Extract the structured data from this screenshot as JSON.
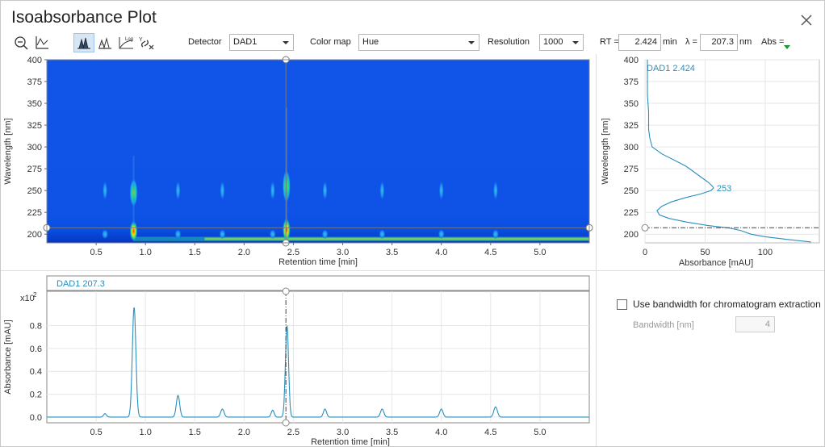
{
  "window": {
    "title": "Isoabsorbance Plot"
  },
  "toolbar": {
    "icons": [
      "zoom-out-icon",
      "chromatogram-axes-icon",
      "isoabsorbance-peaks-icon",
      "peaks-outline-icon",
      "log-scale-icon",
      "unlink-axes-icon"
    ],
    "log_label": "Log",
    "detector_label": "Detector",
    "detector_value": "DAD1",
    "colormap_label": "Color map",
    "colormap_value": "Hue",
    "resolution_label": "Resolution",
    "resolution_value": "1000",
    "rt_label": "RT =",
    "rt_value": "2.424",
    "rt_unit": "min",
    "lambda_label": "λ =",
    "lambda_value": "207.3",
    "lambda_unit": "nm",
    "abs_label": "Abs ="
  },
  "bandwidth": {
    "checkbox_label": "Use bandwidth for chromatogram extraction",
    "checked": false,
    "bw_label": "Bandwidth [nm]",
    "bw_value": "4"
  },
  "chart_data": [
    {
      "name": "isoabsorbance-map",
      "type": "heatmap",
      "xlabel": "Retention time [min]",
      "ylabel": "Wavelength [nm]",
      "xlim": [
        0,
        5.5
      ],
      "ylim": [
        190,
        400
      ],
      "xticks": [
        "0.5",
        "1.0",
        "1.5",
        "2.0",
        "2.5",
        "3.0",
        "3.5",
        "4.0",
        "4.5",
        "5.0"
      ],
      "yticks": [
        "200",
        "225",
        "250",
        "275",
        "300",
        "325",
        "350",
        "375",
        "400"
      ],
      "cursor_rt": 2.424,
      "cursor_wavelength": 207.3,
      "hotspots": [
        {
          "rt": 0.88,
          "wl_from": 235,
          "wl_to": 260,
          "level": 0.55
        },
        {
          "rt": 0.88,
          "wl_from": 195,
          "wl_to": 212,
          "level": 1.0
        },
        {
          "rt": 2.43,
          "wl_from": 240,
          "wl_to": 270,
          "level": 0.45
        },
        {
          "rt": 2.43,
          "wl_from": 195,
          "wl_to": 215,
          "level": 0.9
        }
      ],
      "colormap": "Hue"
    },
    {
      "name": "spectrum",
      "type": "line",
      "series_label": "DAD1 2.424",
      "xlabel": "Absorbance [mAU]",
      "ylabel": "Wavelength [nm]",
      "xlim": [
        0,
        145
      ],
      "ylim": [
        190,
        400
      ],
      "xticks": [
        "0",
        "50",
        "100"
      ],
      "yticks": [
        "200",
        "225",
        "250",
        "275",
        "300",
        "325",
        "350",
        "375",
        "400"
      ],
      "annotation": "253",
      "annotation_at": {
        "abs": 57,
        "wl": 253
      },
      "cursor_wavelength": 207.3,
      "points": [
        [
          2,
          400
        ],
        [
          2,
          380
        ],
        [
          2,
          360
        ],
        [
          3,
          340
        ],
        [
          3,
          320
        ],
        [
          4,
          310
        ],
        [
          6,
          300
        ],
        [
          14,
          292
        ],
        [
          24,
          285
        ],
        [
          34,
          278
        ],
        [
          42,
          270
        ],
        [
          48,
          264
        ],
        [
          53,
          259
        ],
        [
          56,
          255
        ],
        [
          57,
          253
        ],
        [
          55,
          250
        ],
        [
          46,
          246
        ],
        [
          34,
          242
        ],
        [
          22,
          237
        ],
        [
          14,
          232
        ],
        [
          10,
          227
        ],
        [
          12,
          222
        ],
        [
          20,
          218
        ],
        [
          34,
          214
        ],
        [
          52,
          210
        ],
        [
          70,
          207
        ],
        [
          80,
          204
        ],
        [
          88,
          200
        ],
        [
          100,
          197
        ],
        [
          118,
          194
        ],
        [
          138,
          191
        ]
      ]
    },
    {
      "name": "chromatogram",
      "type": "line",
      "series_label": "DAD1 207.3",
      "xlabel": "Retention time [min]",
      "ylabel": "Absorbance [mAU]",
      "y_multiplier": "x10 2",
      "xlim": [
        0,
        5.5
      ],
      "ylim": [
        -0.05,
        1.1
      ],
      "xticks": [
        "0.5",
        "1.0",
        "1.5",
        "2.0",
        "2.5",
        "3.0",
        "3.5",
        "4.0",
        "4.5",
        "5.0"
      ],
      "yticks": [
        "0.0",
        "0.2",
        "0.4",
        "0.6",
        "0.8"
      ],
      "cursor_rt": 2.424,
      "baseline": 0.0,
      "peaks": [
        {
          "rt": 0.59,
          "height": 0.03,
          "width": 0.015
        },
        {
          "rt": 0.885,
          "height": 0.96,
          "width": 0.018
        },
        {
          "rt": 1.33,
          "height": 0.19,
          "width": 0.017
        },
        {
          "rt": 1.78,
          "height": 0.07,
          "width": 0.017
        },
        {
          "rt": 2.29,
          "height": 0.06,
          "width": 0.015
        },
        {
          "rt": 2.435,
          "height": 0.8,
          "width": 0.016
        },
        {
          "rt": 2.82,
          "height": 0.07,
          "width": 0.016
        },
        {
          "rt": 3.4,
          "height": 0.07,
          "width": 0.017
        },
        {
          "rt": 4.0,
          "height": 0.07,
          "width": 0.017
        },
        {
          "rt": 4.55,
          "height": 0.09,
          "width": 0.018
        }
      ]
    }
  ],
  "colors": {
    "accent": "#2a8fbd",
    "map_bg": "#1055e8",
    "cursor": "#555555"
  }
}
